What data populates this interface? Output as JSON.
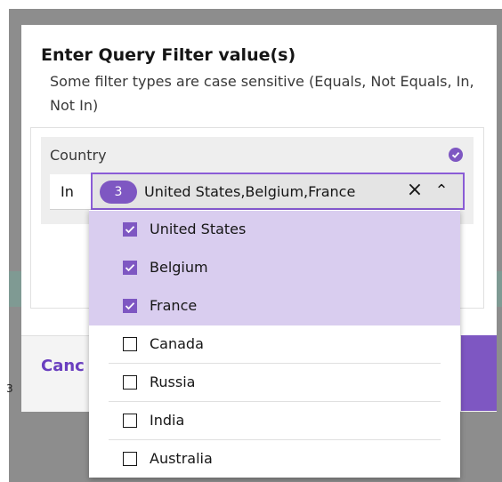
{
  "modal": {
    "title": "Enter Query Filter value(s)",
    "description": "Some filter types are case sensitive (Equals, Not Equals, In, Not In)",
    "cancel_label": "Canc",
    "background_glyph": "3"
  },
  "filter": {
    "field_label": "Country",
    "operator": "In",
    "selected_count": "3",
    "selected_text": "United States,Belgium,France",
    "clear_icon": "×",
    "collapse_icon": "⌃",
    "options": [
      {
        "label": "United States",
        "checked": true
      },
      {
        "label": "Belgium",
        "checked": true
      },
      {
        "label": "France",
        "checked": true
      },
      {
        "label": "Canada",
        "checked": false
      },
      {
        "label": "Russia",
        "checked": false
      },
      {
        "label": "India",
        "checked": false
      },
      {
        "label": "Australia",
        "checked": false
      }
    ]
  },
  "colors": {
    "accent": "#7e57c2",
    "selected_row": "#d9cdef",
    "backdrop": "#8d8d8d"
  }
}
